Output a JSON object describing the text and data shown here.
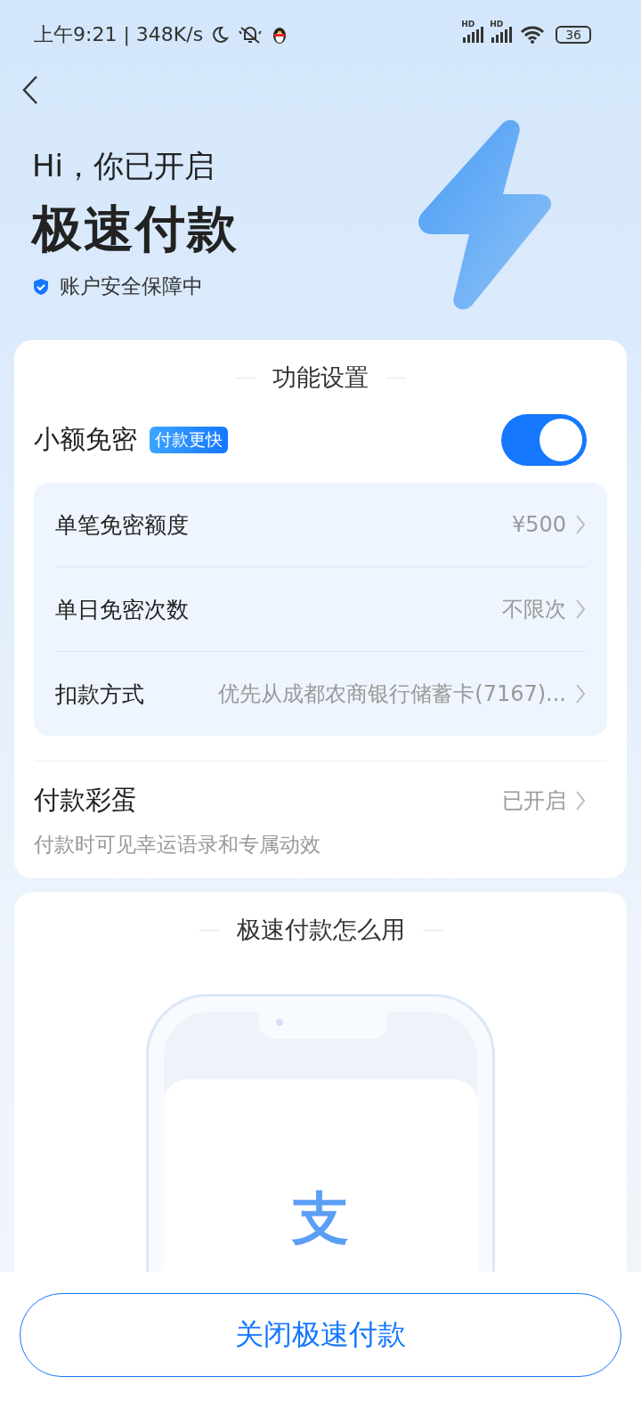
{
  "status_bar": {
    "time_speed": "上午9:21 | 348K/s",
    "network_labels": [
      "HD",
      "HD"
    ],
    "battery": "36"
  },
  "header": {
    "greeting": "Hi，你已开启",
    "title": "极速付款",
    "security": "账户安全保障中"
  },
  "settings_card": {
    "title": "功能设置",
    "small_free": {
      "label": "小额免密",
      "badge": "付款更快",
      "on": true
    },
    "rows": [
      {
        "label": "单笔免密额度",
        "value": "¥500"
      },
      {
        "label": "单日免密次数",
        "value": "不限次"
      },
      {
        "label": "扣款方式",
        "value": "优先从成都农商银行储蓄卡(7167)..."
      }
    ],
    "easter_egg": {
      "label": "付款彩蛋",
      "value": "已开启",
      "description": "付款时可见幸运语录和专属动效"
    }
  },
  "howto_card": {
    "title": "极速付款怎么用",
    "logo_text": "支"
  },
  "bottom_button": "关闭极速付款"
}
